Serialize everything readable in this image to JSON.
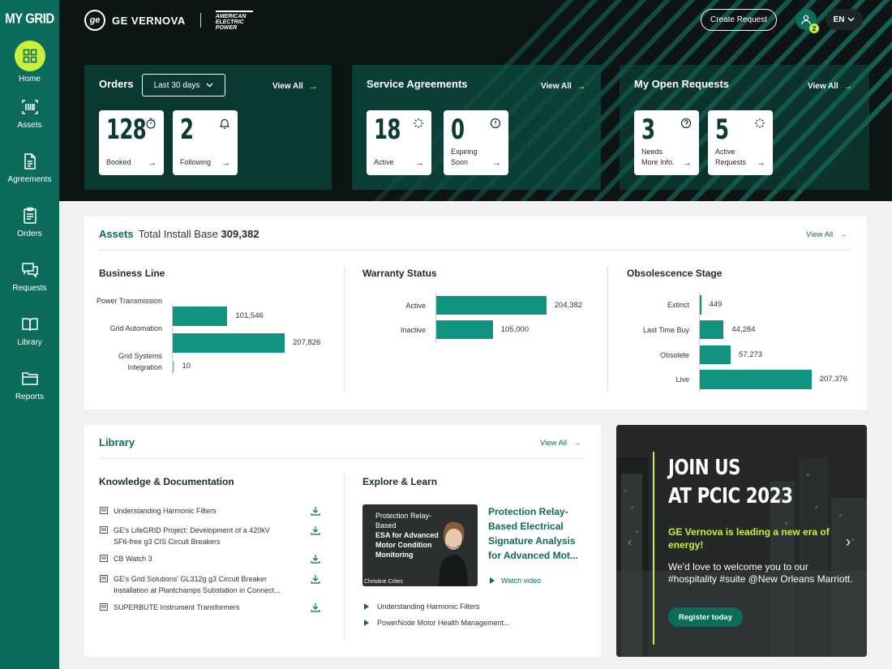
{
  "sidebar": {
    "brand": "MY GRID",
    "items": [
      {
        "label": "Home"
      },
      {
        "label": "Assets"
      },
      {
        "label": "Agreements"
      },
      {
        "label": "Orders"
      },
      {
        "label": "Requests"
      },
      {
        "label": "Library"
      },
      {
        "label": "Reports"
      }
    ]
  },
  "topbar": {
    "company": "GE VERNOVA",
    "partner": "AMERICAN ELECTRIC POWER",
    "create_request": "Create Request",
    "notification_count": "2",
    "language": "EN"
  },
  "orders": {
    "title": "Orders",
    "filter": "Last 30 days",
    "view_all": "View All",
    "cards": [
      {
        "value": "128",
        "label": "Booked"
      },
      {
        "value": "2",
        "label": "Following"
      }
    ]
  },
  "service_agreements": {
    "title": "Service Agreements",
    "view_all": "View All",
    "cards": [
      {
        "value": "18",
        "label": "Active"
      },
      {
        "value": "0",
        "label_line1": "Expiring",
        "label_line2": "Soon"
      }
    ]
  },
  "open_requests": {
    "title": "My Open Requests",
    "view_all": "View All",
    "cards": [
      {
        "value": "3",
        "label_line1": "Needs",
        "label_line2": "More Info."
      },
      {
        "value": "5",
        "label_line1": "Active",
        "label_line2": "Requests"
      }
    ]
  },
  "assets": {
    "title": "Assets",
    "subtitle": "Total Install Base",
    "total": "309,382",
    "view_all": "View All"
  },
  "chart_data": [
    {
      "type": "bar",
      "title": "Business Line",
      "orientation": "horizontal",
      "categories": [
        "Power Transmission",
        "Grid Automation",
        "Grid Systems Integration"
      ],
      "values": [
        101546,
        207826,
        10
      ],
      "value_labels": [
        "101,546",
        "207,826",
        "10"
      ]
    },
    {
      "type": "bar",
      "title": "Warranty Status",
      "orientation": "horizontal",
      "categories": [
        "Active",
        "Inactive"
      ],
      "values": [
        204382,
        105000
      ],
      "value_labels": [
        "204,382",
        "105,000"
      ]
    },
    {
      "type": "bar",
      "title": "Obsolescence Stage",
      "orientation": "horizontal",
      "categories": [
        "Extinct",
        "Last Time Buy",
        "Obsolete",
        "Live"
      ],
      "values": [
        449,
        44284,
        57273,
        207376
      ],
      "value_labels": [
        "449",
        "44,284",
        "57,273",
        "207,376"
      ]
    }
  ],
  "library": {
    "title": "Library",
    "view_all": "View All",
    "knowledge_title": "Knowledge & Documentation",
    "documents": [
      {
        "line1": "Understanding Harmonic Filters",
        "line2": ""
      },
      {
        "line1": "GE's LifeGRID Project: Development of a 420kV",
        "line2": "SF6-free g3 CIS Circuit Breakers"
      },
      {
        "line1": "CB Watch 3",
        "line2": ""
      },
      {
        "line1": "GE's Grid Solutions' GL312g g3 Circuit Breaker",
        "line2": "Installation at Plantchamps Substation in Connect..."
      },
      {
        "line1": "SUPERBUTE Instrument Transformers",
        "line2": ""
      }
    ],
    "explore_title": "Explore & Learn",
    "video": {
      "thumb_line1": "Protection Relay-Based",
      "thumb_line2": "ESA for Advanced",
      "thumb_line3": "Motor Condition",
      "thumb_line4": "Monitoring",
      "presenter": "Christine Crites",
      "title": "Protection Relay-Based Electrical Signature Analysis for Advanced Mot...",
      "watch_label": "Watch video"
    },
    "playlist": [
      {
        "label": "Understanding Harmonic Filters"
      },
      {
        "label": "PowerNode Motor Health Management..."
      }
    ]
  },
  "promo": {
    "headline_line1": "JOIN US",
    "headline_line2": "AT PCIC 2023",
    "sub": "GE Vernova is leading a new era of energy!",
    "body": "We'd love to welcome you to our #hospitality #suite @New Orleans Marriott.",
    "button": "Register today"
  },
  "colors": {
    "sidebar": "#0d6b5c",
    "accent": "#c8f03c",
    "bar": "#12937f",
    "hero_bg": "#0d1414"
  }
}
